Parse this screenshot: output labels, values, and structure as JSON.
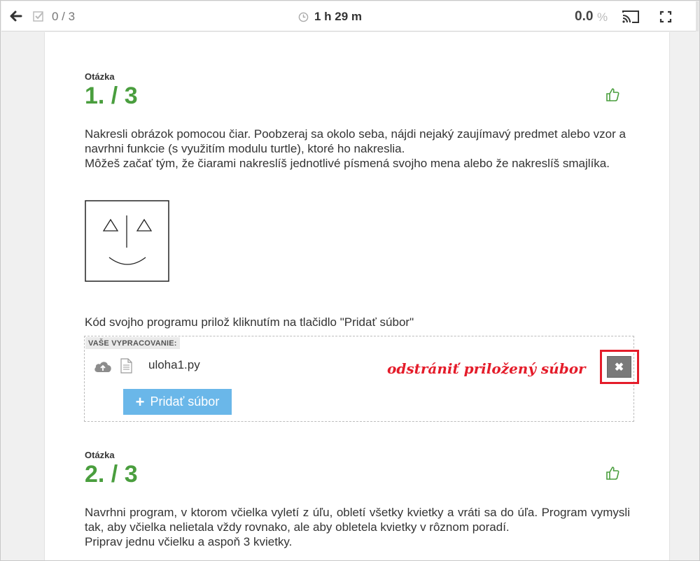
{
  "topbar": {
    "progress": "0 / 3",
    "timer": "1 h 29 m",
    "score": "0.0",
    "score_unit": "%"
  },
  "questions": [
    {
      "label": "Otázka",
      "number": "1. / 3",
      "text": [
        "Nakresli obrázok pomocou čiar. Poobzeraj sa okolo seba, nájdi nejaký zaujímavý predmet alebo vzor a navrhni funkcie (s využitím modulu turtle), ktoré ho nakreslia.",
        "Môžeš začať tým, že čiarami nakreslíš jednotlivé písmená svojho mena alebo že nakreslíš smajlíka."
      ],
      "attach_note": "Kód svojho programu prilož kliknutím na tlačidlo \"Pridať súbor\"",
      "answer": {
        "label": "VAŠE VYPRACOVANIE:",
        "file_name": "uloha1.py",
        "annotation": "odstrániť priložený súbor",
        "remove_symbol": "✖",
        "add_file_label": "Pridať súbor"
      }
    },
    {
      "label": "Otázka",
      "number": "2. / 3",
      "text": [
        "Navrhni program, v ktorom včielka vyletí z úľu, obletí všetky kvietky a vráti sa do úľa. Program vymysli tak, aby včielka nelietala vždy rovnako, ale aby obletela kvietky v rôznom poradí.",
        "Priprav jednu včielku a aspoň 3 kvietky."
      ]
    }
  ],
  "colors": {
    "accent_green": "#4a9e3e",
    "annotation_red": "#e41c2a",
    "button_blue": "#6ab7e9"
  }
}
